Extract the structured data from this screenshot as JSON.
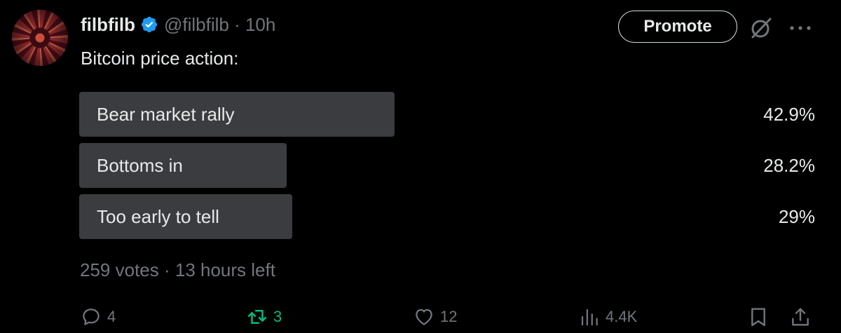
{
  "author": {
    "display_name": "filbfilb",
    "handle": "@filbfilb",
    "separator": " · ",
    "time": "10h",
    "verified_icon": "verified-badge-icon"
  },
  "header": {
    "promote_label": "Promote",
    "grok_icon": "grok-icon",
    "more_icon": "more-icon"
  },
  "tweet": {
    "text": "Bitcoin price action:"
  },
  "poll": {
    "options": [
      {
        "label": "Bear market rally",
        "percent": "42.9%",
        "value": 42.9
      },
      {
        "label": "Bottoms in",
        "percent": "28.2%",
        "value": 28.2
      },
      {
        "label": "Too early to tell",
        "percent": "29%",
        "value": 29
      }
    ],
    "votes": "259 votes",
    "separator": " · ",
    "time_left": "13 hours left"
  },
  "actions": {
    "replies": "4",
    "reposts": "3",
    "likes": "12",
    "views": "4.4K"
  },
  "colors": {
    "background": "#000000",
    "text": "#e7e9ea",
    "muted": "#71767b",
    "poll_bar": "#3a3c3f",
    "repost_active": "#00ba7c",
    "verified": "#1d9bf0"
  }
}
